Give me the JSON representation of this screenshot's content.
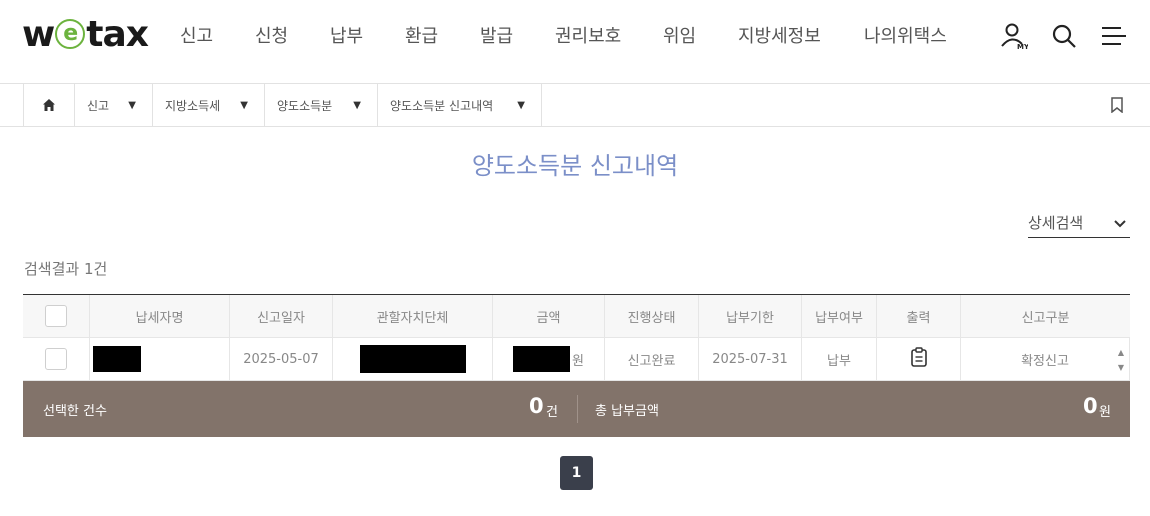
{
  "header": {
    "logo_w": "w",
    "logo_e": "e",
    "logo_rest": "tax",
    "nav": [
      "신고",
      "신청",
      "납부",
      "환급",
      "발급",
      "권리보호",
      "위임",
      "지방세정보",
      "나의위택스"
    ],
    "icons": {
      "my": "user-my-icon",
      "my_label": "MY",
      "search": "search-icon",
      "menu": "hamburger-menu-icon"
    }
  },
  "breadcrumb": {
    "home_icon": "home-icon",
    "items": [
      "신고",
      "지방소득세",
      "양도소득분",
      "양도소득분 신고내역"
    ],
    "bookmark_icon": "bookmark-icon"
  },
  "page": {
    "title": "양도소득분 신고내역",
    "detail_search": "상세검색",
    "result_count": "검색결과 1건"
  },
  "table": {
    "columns": [
      "납세자명",
      "신고일자",
      "관할자치단체",
      "금액",
      "진행상태",
      "납부기한",
      "납부여부",
      "출력",
      "신고구분"
    ],
    "rows": [
      {
        "taxpayer": "",
        "report_date": "2025-05-07",
        "jurisdiction": "",
        "amount": "",
        "amount_unit": "원",
        "status": "신고완료",
        "due_date": "2025-07-31",
        "paid": "납부",
        "print_icon": "clipboard-icon",
        "type": "확정신고"
      }
    ]
  },
  "summary": {
    "selected_label": "선택한 건수",
    "selected_count": "0",
    "selected_unit": "건",
    "total_label": "총 납부금액",
    "total_amount": "0",
    "total_unit": "원"
  },
  "pagination": {
    "current": "1"
  },
  "colors": {
    "accent_title": "#7b8fc8",
    "logo_green": "#6cb33e",
    "summary_bar": "#82736a",
    "pager": "#3a3f4b"
  }
}
